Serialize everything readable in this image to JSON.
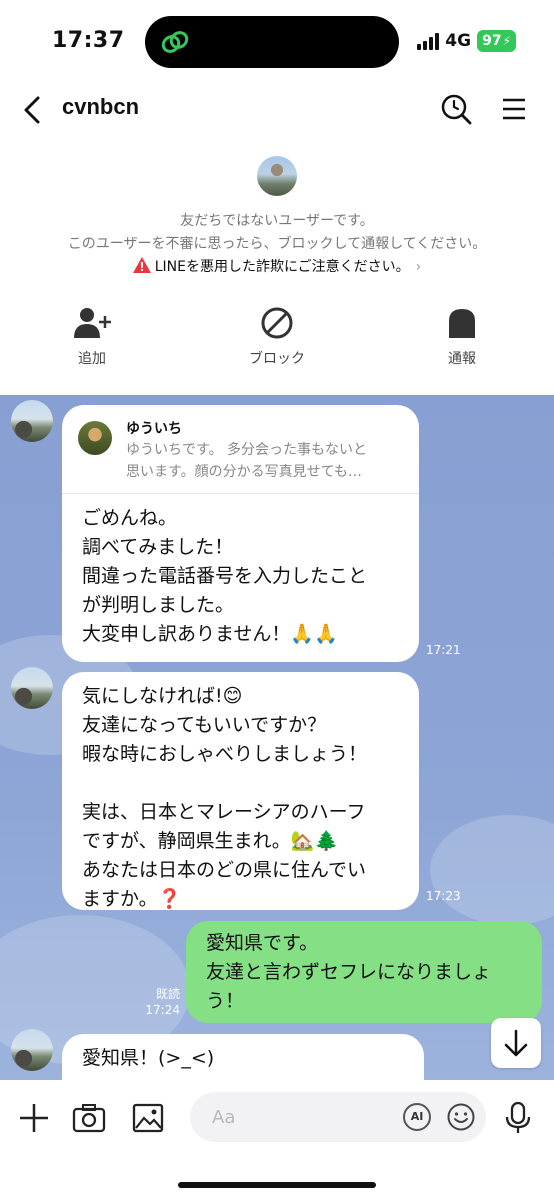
{
  "status_bar": {
    "time": "17:37",
    "network": "4G",
    "battery": "97"
  },
  "header": {
    "title": "cvnbcn"
  },
  "notice": {
    "line1": "友だちではないユーザーです。",
    "line2": "このユーザーを不審に思ったら、ブロックして通報してください。",
    "warning": "LINEを悪用した詐欺にご注意ください。"
  },
  "actions": {
    "add": "追加",
    "block": "ブロック",
    "report": "通報"
  },
  "messages": [
    {
      "reply_name": "ゆういち",
      "reply_text_1": "ゆういちです。 多分会った事もないと",
      "reply_text_2": "思います。顔の分かる写真見せても…",
      "text": "ごめんね。\n調べてみました！\n間違った電話番号を入力したこと\nが判明しました。\n大変申し訳ありません！🙏🙏",
      "time": "17:21"
    },
    {
      "text": "気にしなければ!😊\n友達になってもいいですか？\n暇な時におしゃべりしましょう！\n\n実は、日本とマレーシアのハーフ\nですが、静岡県生まれ。🏡🌲\nあなたは日本のどの県に住んでい\nますか。❓",
      "time": "17:23"
    },
    {
      "text": "愛知県です。\n友達と言わずセフレになりましょ\nう！",
      "read": "既読",
      "time": "17:24"
    },
    {
      "text": "愛知県！(>_<)"
    }
  ],
  "input": {
    "placeholder": "Aa",
    "ai_label": "AI"
  }
}
